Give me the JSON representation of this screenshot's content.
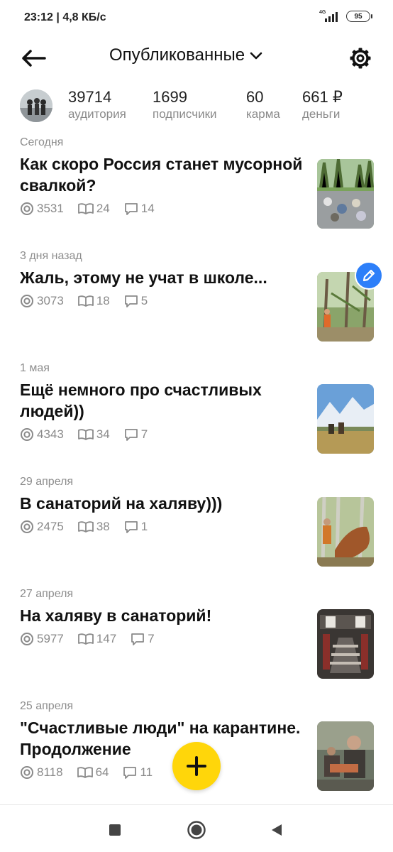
{
  "status_bar": {
    "time": "23:12",
    "separator": "|",
    "speed": "4,8 КБ/с",
    "network": "4G",
    "battery": "95"
  },
  "header": {
    "title": "Опубликованные",
    "back_icon": "arrow-left-icon",
    "dropdown_icon": "chevron-down-icon",
    "settings_icon": "gear-icon"
  },
  "stats": [
    {
      "value": "39714",
      "label": "аудитория"
    },
    {
      "value": "1699",
      "label": "подписчики"
    },
    {
      "value": "60",
      "label": "карма"
    },
    {
      "value": "661 ₽",
      "label": "деньги"
    }
  ],
  "articles": [
    {
      "date": "Сегодня",
      "title": "Как скоро Россия станет мусорной свалкой?",
      "views": "3531",
      "reads": "24",
      "comments": "14"
    },
    {
      "date": "3 дня назад",
      "title": "Жаль, этому не учат в школе...",
      "views": "3073",
      "reads": "18",
      "comments": "5"
    },
    {
      "date": "1 мая",
      "title": "Ещё немного про счастливых людей))",
      "views": "4343",
      "reads": "34",
      "comments": "7"
    },
    {
      "date": "29 апреля",
      "title": "В санаторий на халяву)))",
      "views": "2475",
      "reads": "38",
      "comments": "1"
    },
    {
      "date": "27 апреля",
      "title": "На халяву в санаторий!",
      "views": "5977",
      "reads": "147",
      "comments": "7"
    },
    {
      "date": "25 апреля",
      "title": "\"Счастливые люди\" на карантине. Продолжение",
      "views": "8118",
      "reads": "64",
      "comments": "11"
    }
  ],
  "colors": {
    "fab": "#ffd60a",
    "edit_badge": "#2d7ff9"
  },
  "nav": {
    "recent_icon": "square-icon",
    "home_icon": "circle-icon",
    "back_icon": "triangle-back-icon"
  }
}
